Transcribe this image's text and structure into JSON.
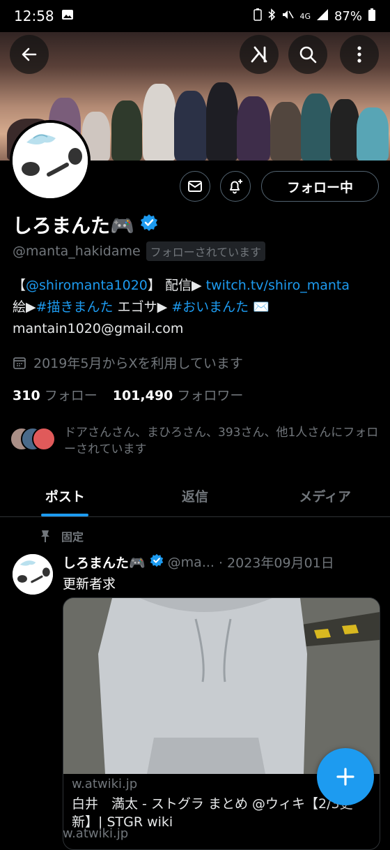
{
  "status_bar": {
    "time": "12:58",
    "signal_label": "4G",
    "battery": "87%"
  },
  "profile": {
    "name": "しろまんた🎮",
    "handle": "@manta_hakidame",
    "follows_you_badge": "フォローされています",
    "bio_line1_prefix": "【",
    "bio_mention": "@shiromanta1020",
    "bio_line1_mid": "】 配信▶",
    "bio_link": "twitch.tv/shiro_manta",
    "bio_line2_prefix": "絵▶",
    "bio_hashtag1": "#描きまんた",
    "bio_line2_mid": " エゴサ▶ ",
    "bio_hashtag2": "#おいまんた",
    "bio_line2_suffix": " ✉️",
    "bio_line3": "mantain1020@gmail.com",
    "joined": "2019年5月からXを利用しています",
    "following_count": "310",
    "following_label": "フォロー",
    "followers_count": "101,490",
    "followers_label": "フォロワー",
    "followed_by": "ドアさんさん、まひろさん、393さん、他1人さんにフォローされています",
    "follow_button": "フォロー中"
  },
  "tabs": [
    {
      "label": "ポスト",
      "active": true
    },
    {
      "label": "返信",
      "active": false
    },
    {
      "label": "メディア",
      "active": false
    }
  ],
  "pinned_post": {
    "pinned_label": "固定",
    "author_name": "しろまんた🎮",
    "author_handle": "@ma...",
    "date": "· 2023年09月01日",
    "text": "更新者求",
    "card": {
      "domain": "w.atwiki.jp",
      "title": "白井　満太 - ストグラ まとめ @ウィキ【2/3更新】| STGR wiki"
    },
    "next_domain": "w.atwiki.jp"
  },
  "colors": {
    "accent": "#1d9bf0",
    "background": "#000000",
    "muted": "#71767b"
  }
}
